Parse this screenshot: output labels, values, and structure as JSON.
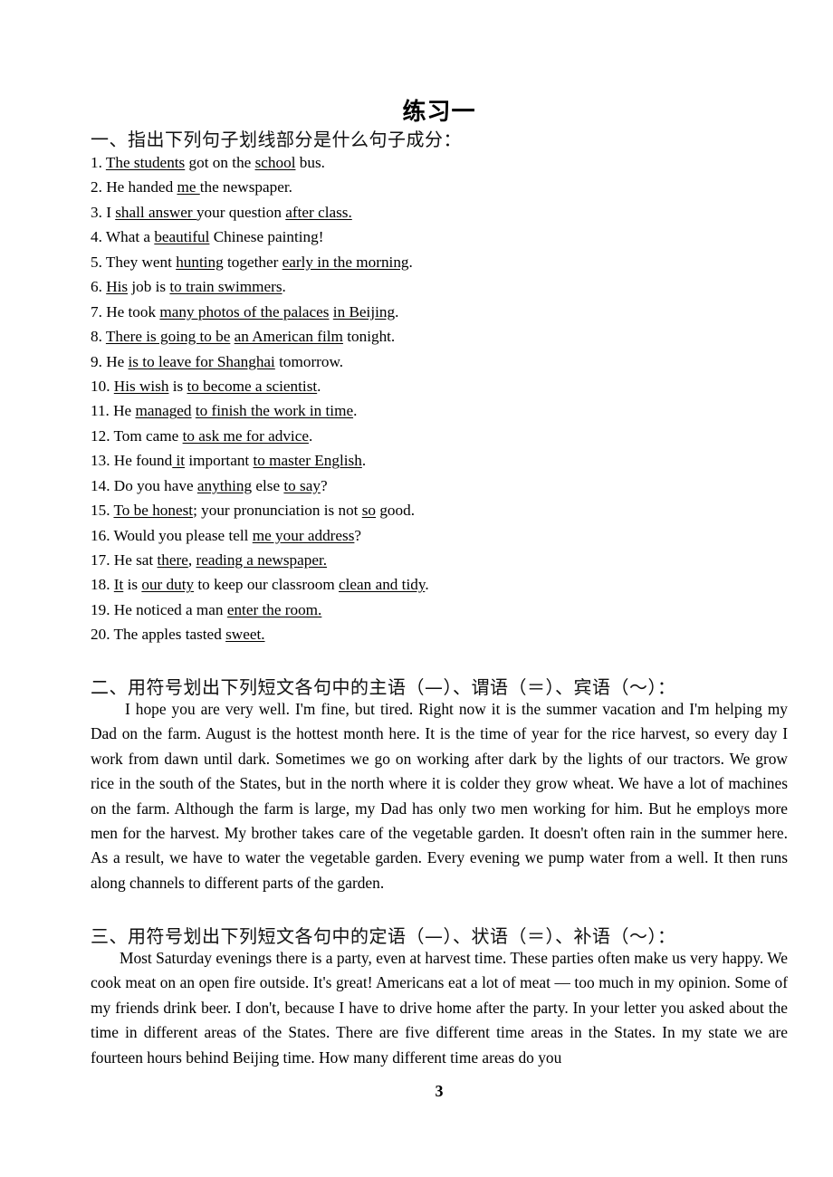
{
  "title": "练习一",
  "section1": {
    "heading": "一、指出下列句子划线部分是什么句子成分：",
    "sentences": [
      [
        {
          "t": "1. "
        },
        {
          "t": "The students",
          "u": true
        },
        {
          "t": " got on the "
        },
        {
          "t": "school",
          "u": true
        },
        {
          "t": " bus."
        }
      ],
      [
        {
          "t": "2. He handed "
        },
        {
          "t": "me ",
          "u": true
        },
        {
          "t": "the newspaper."
        }
      ],
      [
        {
          "t": "3. I "
        },
        {
          "t": "shall answer ",
          "u": true
        },
        {
          "t": "your question "
        },
        {
          "t": "after class.",
          "u": true
        }
      ],
      [
        {
          "t": "4. What a "
        },
        {
          "t": "beautiful",
          "u": true
        },
        {
          "t": " Chinese painting!"
        }
      ],
      [
        {
          "t": "5. They went "
        },
        {
          "t": "hunting",
          "u": true
        },
        {
          "t": " together "
        },
        {
          "t": "early in the morning",
          "u": true
        },
        {
          "t": "."
        }
      ],
      [
        {
          "t": "6. "
        },
        {
          "t": "His",
          "u": true
        },
        {
          "t": " job is "
        },
        {
          "t": "to train swimmers",
          "u": true
        },
        {
          "t": "."
        }
      ],
      [
        {
          "t": "7. He took "
        },
        {
          "t": "many photos of the palaces",
          "u": true
        },
        {
          "t": " "
        },
        {
          "t": "in Beijing",
          "u": true
        },
        {
          "t": "."
        }
      ],
      [
        {
          "t": "8. "
        },
        {
          "t": "There is going to be",
          "u": true
        },
        {
          "t": " "
        },
        {
          "t": "an American film",
          "u": true
        },
        {
          "t": " tonight."
        }
      ],
      [
        {
          "t": "9. He "
        },
        {
          "t": "is to leave for Shanghai",
          "u": true
        },
        {
          "t": " tomorrow."
        }
      ],
      [
        {
          "t": "10. "
        },
        {
          "t": "His wish",
          "u": true
        },
        {
          "t": " is "
        },
        {
          "t": "to become a scientist",
          "u": true
        },
        {
          "t": "."
        }
      ],
      [
        {
          "t": "11. He "
        },
        {
          "t": "managed",
          "u": true
        },
        {
          "t": " "
        },
        {
          "t": "to finish the work in time",
          "u": true
        },
        {
          "t": "."
        }
      ],
      [
        {
          "t": "12. Tom came "
        },
        {
          "t": "to ask me for advice",
          "u": true
        },
        {
          "t": "."
        }
      ],
      [
        {
          "t": "13. He found"
        },
        {
          "t": " it",
          "u": true
        },
        {
          "t": " important "
        },
        {
          "t": "to master English",
          "u": true
        },
        {
          "t": "."
        }
      ],
      [
        {
          "t": "14. Do you have "
        },
        {
          "t": "anything",
          "u": true
        },
        {
          "t": " else "
        },
        {
          "t": "to say",
          "u": true
        },
        {
          "t": "?"
        }
      ],
      [
        {
          "t": "15. "
        },
        {
          "t": "To be honest",
          "u": true
        },
        {
          "t": "; your pronunciation is not "
        },
        {
          "t": "so",
          "u": true
        },
        {
          "t": " good."
        }
      ],
      [
        {
          "t": "16. Would you please tell "
        },
        {
          "t": "me your address",
          "u": true
        },
        {
          "t": "?"
        }
      ],
      [
        {
          "t": "17. He sat "
        },
        {
          "t": "there",
          "u": true
        },
        {
          "t": ", "
        },
        {
          "t": "reading a newspaper.",
          "u": true
        }
      ],
      [
        {
          "t": "18. "
        },
        {
          "t": "It",
          "u": true
        },
        {
          "t": " is "
        },
        {
          "t": "our duty",
          "u": true
        },
        {
          "t": " to keep our classroom "
        },
        {
          "t": "clean and tidy",
          "u": true
        },
        {
          "t": "."
        }
      ],
      [
        {
          "t": "19. He noticed a man "
        },
        {
          "t": "enter the room.",
          "u": true
        }
      ],
      [
        {
          "t": "20. The apples tasted "
        },
        {
          "t": "sweet.",
          "u": true
        }
      ]
    ]
  },
  "section2": {
    "heading": "二、用符号划出下列短文各句中的主语（—）、谓语（＝）、宾语（～）：",
    "paragraph": "I hope you are very well. I'm fine, but tired. Right now it is the summer vacation and I'm helping my Dad on the farm. August is the hottest month here. It is the time of year for the rice harvest, so every day I work from dawn until dark. Sometimes we go on working after dark by the lights of our tractors. We grow rice in the south of the States, but in the north where it is colder they grow wheat. We have a lot of machines on the farm. Although the farm is large, my Dad has only two men working for him. But he employs more men for the harvest. My brother takes care of the vegetable garden. It doesn't often rain in the summer here. As a result, we have to water the vegetable garden. Every evening we pump water from a well. It then runs along channels to different parts of the garden."
  },
  "section3": {
    "heading": "三、用符号划出下列短文各句中的定语（—）、状语（＝）、补语（～）：",
    "paragraph": "Most Saturday evenings there is a party, even at harvest time. These parties often make us very happy. We cook meat on an open fire outside. It's great! Americans eat a lot of meat — too much in my opinion. Some of my friends drink beer. I don't, because I have to drive home after the party. In your letter you asked about the time in different areas of the States. There are five different time areas in the States. In my state we are fourteen hours behind Beijing time. How many different time areas do you"
  },
  "page_number": "3"
}
